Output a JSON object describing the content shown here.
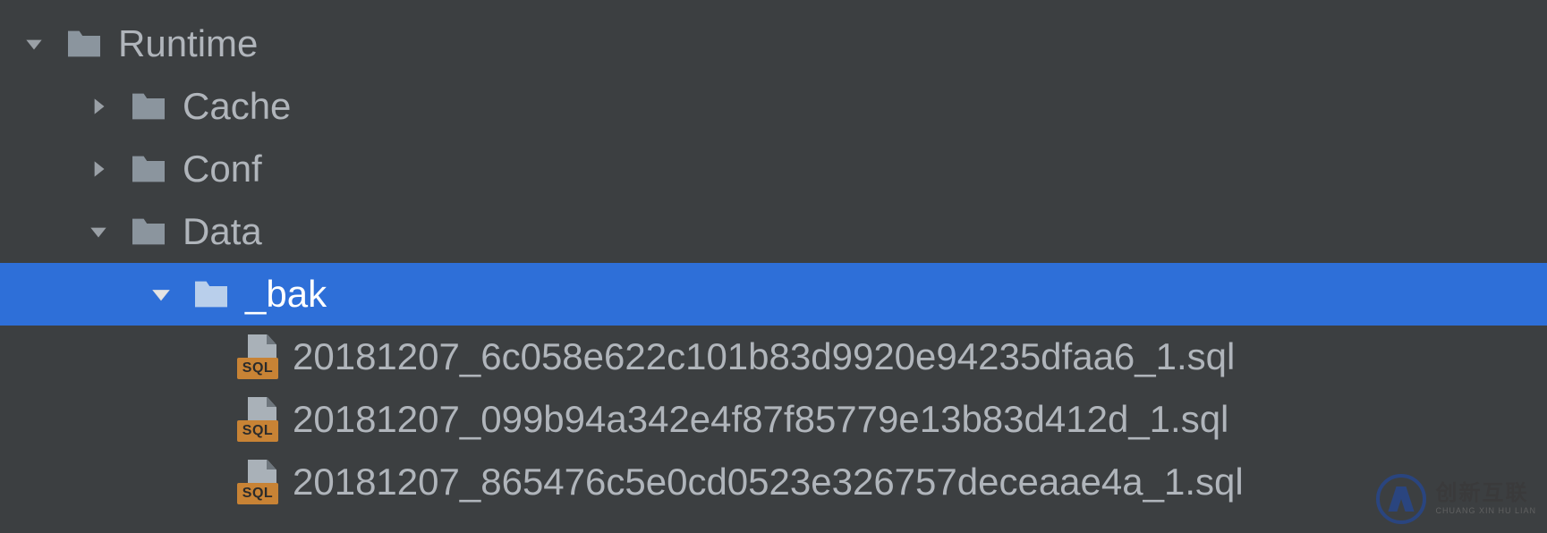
{
  "tree": {
    "runtime": {
      "label": "Runtime"
    },
    "cache": {
      "label": "Cache"
    },
    "conf": {
      "label": "Conf"
    },
    "data": {
      "label": "Data"
    },
    "bak": {
      "label": "_bak"
    },
    "files": [
      {
        "name": "20181207_6c058e622c101b83d9920e94235dfaa6_1.sql"
      },
      {
        "name": "20181207_099b94a342e4f87f85779e13b83d412d_1.sql"
      },
      {
        "name": "20181207_865476c5e0cd0523e326757deceaae4a_1.sql"
      }
    ]
  },
  "sql_badge": "SQL",
  "watermark": {
    "main": "创新互联",
    "sub": "CHUANG XIN HU LIAN"
  }
}
